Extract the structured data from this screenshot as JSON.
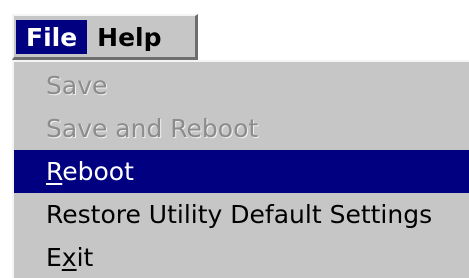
{
  "menubar": {
    "items": [
      {
        "label": "File",
        "active": true
      },
      {
        "label": "Help",
        "active": false
      }
    ]
  },
  "file_menu": {
    "items": [
      {
        "label": "Save",
        "state": "disabled"
      },
      {
        "label": "Save and Reboot",
        "state": "disabled"
      },
      {
        "label": "Reboot",
        "state": "selected",
        "mnemonic_pre": "",
        "mnemonic": "R",
        "mnemonic_post": "eboot"
      },
      {
        "label": "Restore Utility Default Settings",
        "state": "normal"
      },
      {
        "label": "Exit",
        "state": "normal",
        "mnemonic_pre": "E",
        "mnemonic": "x",
        "mnemonic_post": "it"
      }
    ]
  },
  "colors": {
    "menu_background": "#c6c6c6",
    "highlight": "#000080",
    "highlight_text": "#ffffff",
    "disabled_text": "#8c8c8c"
  }
}
